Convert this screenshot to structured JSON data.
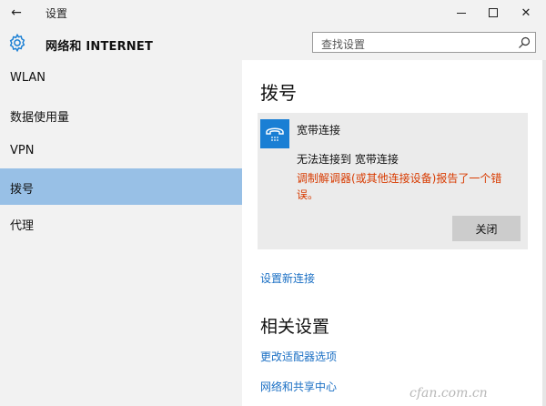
{
  "titlebar": {
    "back_glyph": "←",
    "title": "设置",
    "min_glyph": "–",
    "close_glyph": "✕"
  },
  "header": {
    "title": "网络和 INTERNET",
    "search_placeholder": "查找设置"
  },
  "sidebar": {
    "items": [
      {
        "label": "WLAN",
        "selected": false
      },
      {
        "label": "数据使用量",
        "selected": false
      },
      {
        "label": "VPN",
        "selected": false
      },
      {
        "label": "拨号",
        "selected": true
      },
      {
        "label": "代理",
        "selected": false
      }
    ]
  },
  "main": {
    "title": "拨号",
    "connection": {
      "name": "宽带连接",
      "status": "无法连接到 宽带连接",
      "error": "调制解调器(或其他连接设备)报告了一个错误。",
      "close_label": "关闭",
      "icon": "phone-icon"
    },
    "setup_link": "设置新连接",
    "related": {
      "title": "相关设置",
      "links": [
        "更改适配器选项",
        "网络和共享中心"
      ]
    }
  },
  "watermark": "cfan.com.cn",
  "colors": {
    "accent": "#1a7fd4",
    "selected_bg": "#98c0e6",
    "link": "#1a6fc4",
    "error": "#d83b01",
    "chrome_bg": "#f2f2f2"
  }
}
